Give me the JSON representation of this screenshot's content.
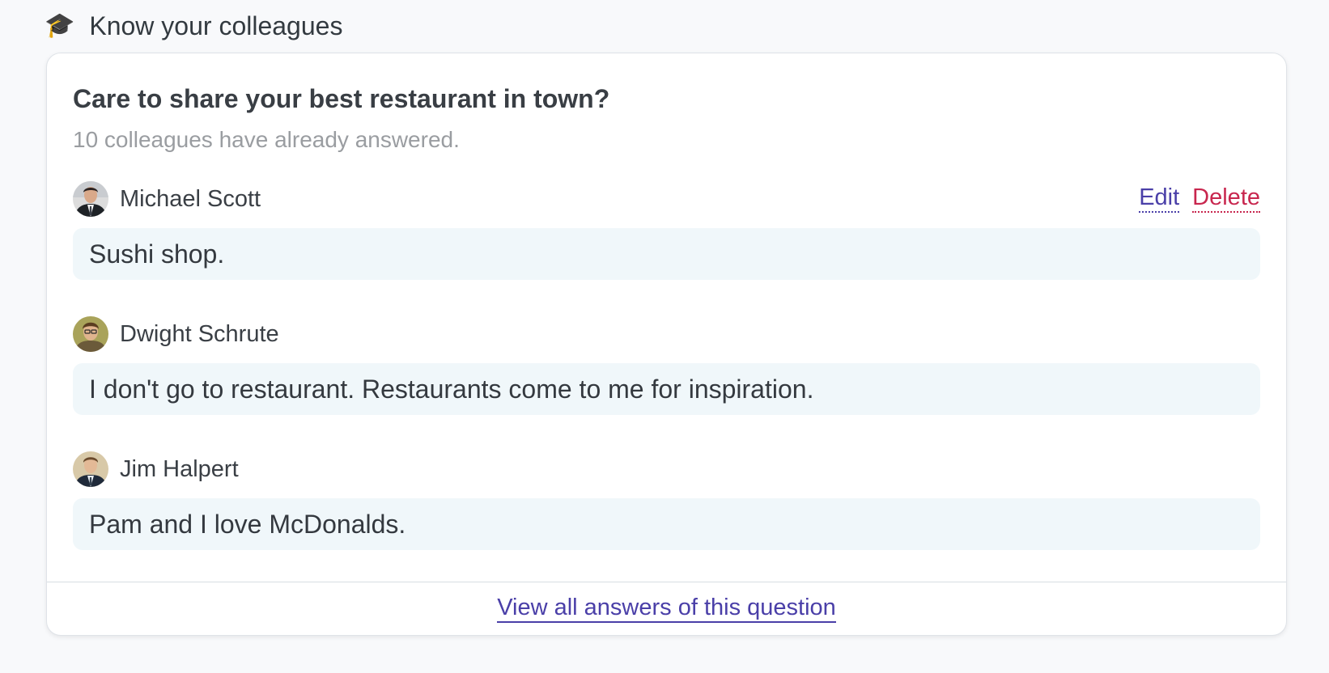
{
  "section": {
    "icon": "graduation-cap-icon",
    "icon_glyph": "🎓",
    "title": "Know your colleagues"
  },
  "card": {
    "question": "Care to share your best restaurant in town?",
    "answered_count": "10 colleagues have already answered.",
    "answers": [
      {
        "author": "Michael Scott",
        "text": "Sushi shop.",
        "edit_label": "Edit",
        "delete_label": "Delete"
      },
      {
        "author": "Dwight Schrute",
        "text": "I don't go to restaurant. Restaurants come to me for inspiration."
      },
      {
        "author": "Jim Halpert",
        "text": "Pam and I love McDonalds."
      }
    ],
    "footer_link": "View all answers of this question"
  },
  "colors": {
    "link": "#4a3fa8",
    "danger": "#c8264e",
    "answer_bg": "#f0f7fa"
  }
}
